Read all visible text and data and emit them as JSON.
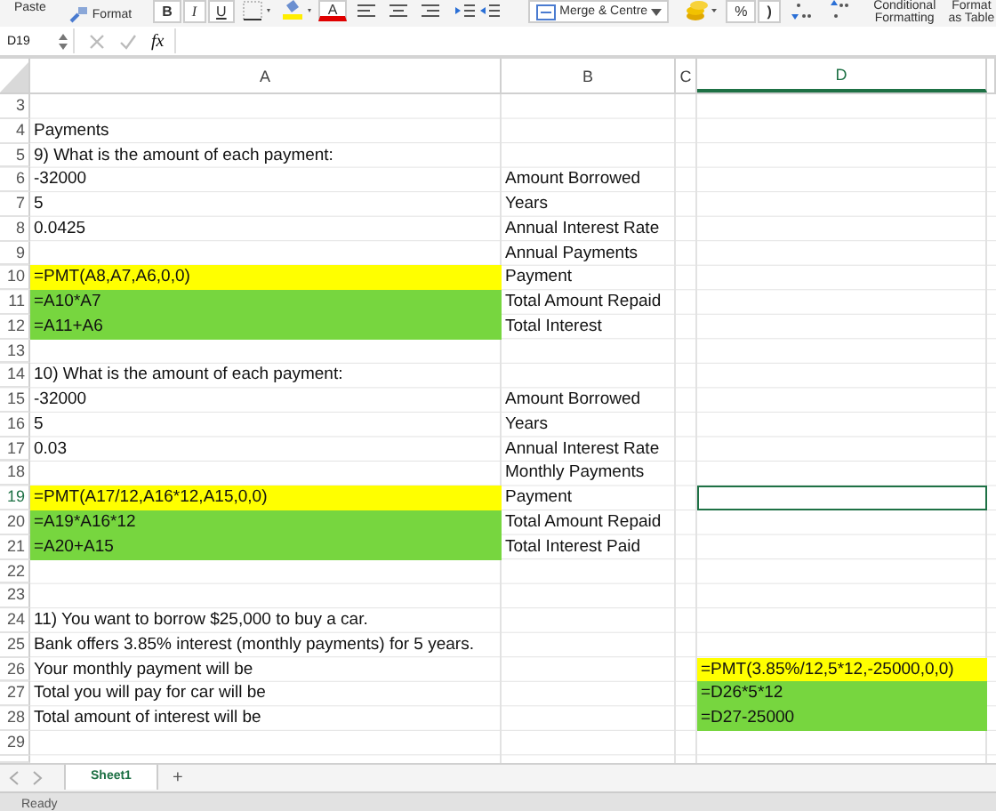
{
  "toolbar": {
    "paste": "Paste",
    "format_painter": "Format",
    "bold": "B",
    "italic": "I",
    "underline": "U",
    "font_color": "A",
    "merge": "Merge & Centre",
    "percent": "%",
    "comma": ")",
    "conditional_formatting": "Conditional Formatting",
    "format_as_table": "Format as Table"
  },
  "formula_bar": {
    "name_box": "D19",
    "fx": "fx"
  },
  "columns": [
    {
      "label": "A",
      "selected": false
    },
    {
      "label": "B",
      "selected": false
    },
    {
      "label": "C",
      "selected": false
    },
    {
      "label": "D",
      "selected": true
    }
  ],
  "rows": [
    {
      "number": "3",
      "selected": false,
      "cells": {}
    },
    {
      "number": "4",
      "selected": false,
      "cells": {
        "a": {
          "text": "Payments"
        }
      }
    },
    {
      "number": "5",
      "selected": false,
      "cells": {
        "a": {
          "text": "9) What is the amount of each payment:"
        }
      }
    },
    {
      "number": "6",
      "selected": false,
      "cells": {
        "a": {
          "text": "-32000"
        },
        "b": {
          "text": "Amount Borrowed"
        }
      }
    },
    {
      "number": "7",
      "selected": false,
      "cells": {
        "a": {
          "text": "5"
        },
        "b": {
          "text": "Years"
        }
      }
    },
    {
      "number": "8",
      "selected": false,
      "cells": {
        "a": {
          "text": "0.0425"
        },
        "b": {
          "text": "Annual Interest Rate"
        }
      }
    },
    {
      "number": "9",
      "selected": false,
      "cells": {
        "b": {
          "text": "Annual Payments"
        }
      }
    },
    {
      "number": "10",
      "selected": false,
      "cells": {
        "a": {
          "text": "=PMT(A8,A7,A6,0,0)",
          "color": "#ffff00"
        },
        "b": {
          "text": "Payment"
        }
      }
    },
    {
      "number": "11",
      "selected": false,
      "cells": {
        "a": {
          "text": "=A10*A7",
          "color": "#77d63f"
        },
        "b": {
          "text": "Total Amount Repaid"
        }
      }
    },
    {
      "number": "12",
      "selected": false,
      "cells": {
        "a": {
          "text": "=A11+A6",
          "color": "#77d63f"
        },
        "b": {
          "text": "Total Interest"
        }
      }
    },
    {
      "number": "13",
      "selected": false,
      "cells": {}
    },
    {
      "number": "14",
      "selected": false,
      "cells": {
        "a": {
          "text": "10) What is the amount of each payment:"
        }
      }
    },
    {
      "number": "15",
      "selected": false,
      "cells": {
        "a": {
          "text": "-32000"
        },
        "b": {
          "text": "Amount Borrowed"
        }
      }
    },
    {
      "number": "16",
      "selected": false,
      "cells": {
        "a": {
          "text": "5"
        },
        "b": {
          "text": "Years"
        }
      }
    },
    {
      "number": "17",
      "selected": false,
      "cells": {
        "a": {
          "text": "0.03"
        },
        "b": {
          "text": "Annual Interest Rate"
        }
      }
    },
    {
      "number": "18",
      "selected": false,
      "cells": {
        "b": {
          "text": "Monthly Payments"
        }
      }
    },
    {
      "number": "19",
      "selected": true,
      "cells": {
        "a": {
          "text": "=PMT(A17/12,A16*12,A15,0,0)",
          "color": "#ffff00"
        },
        "b": {
          "text": "Payment"
        }
      }
    },
    {
      "number": "20",
      "selected": false,
      "cells": {
        "a": {
          "text": "=A19*A16*12",
          "color": "#77d63f"
        },
        "b": {
          "text": "Total Amount Repaid"
        }
      }
    },
    {
      "number": "21",
      "selected": false,
      "cells": {
        "a": {
          "text": "=A20+A15",
          "color": "#77d63f"
        },
        "b": {
          "text": "Total Interest Paid"
        }
      }
    },
    {
      "number": "22",
      "selected": false,
      "cells": {}
    },
    {
      "number": "23",
      "selected": false,
      "cells": {}
    },
    {
      "number": "24",
      "selected": false,
      "cells": {
        "a": {
          "text": "11) You want to borrow $25,000 to buy a car."
        }
      }
    },
    {
      "number": "25",
      "selected": false,
      "cells": {
        "a": {
          "text": "Bank offers 3.85% interest (monthly payments) for 5 years."
        }
      }
    },
    {
      "number": "26",
      "selected": false,
      "cells": {
        "a": {
          "text": "Your monthly payment will be"
        },
        "d": {
          "text": "=PMT(3.85%/12,5*12,-25000,0,0)",
          "color": "#ffff00"
        }
      }
    },
    {
      "number": "27",
      "selected": false,
      "cells": {
        "a": {
          "text": "Total you will pay for car will be"
        },
        "d": {
          "text": "=D26*5*12",
          "color": "#77d63f"
        }
      }
    },
    {
      "number": "28",
      "selected": false,
      "cells": {
        "a": {
          "text": "Total amount of interest will be"
        },
        "d": {
          "text": "=D27-25000",
          "color": "#77d63f"
        }
      }
    },
    {
      "number": "29",
      "selected": false,
      "cells": {}
    }
  ],
  "sheet_tabs": [
    {
      "label": "Sheet1",
      "selected": true
    }
  ],
  "add_sheet": "+",
  "status_bar": "Ready"
}
